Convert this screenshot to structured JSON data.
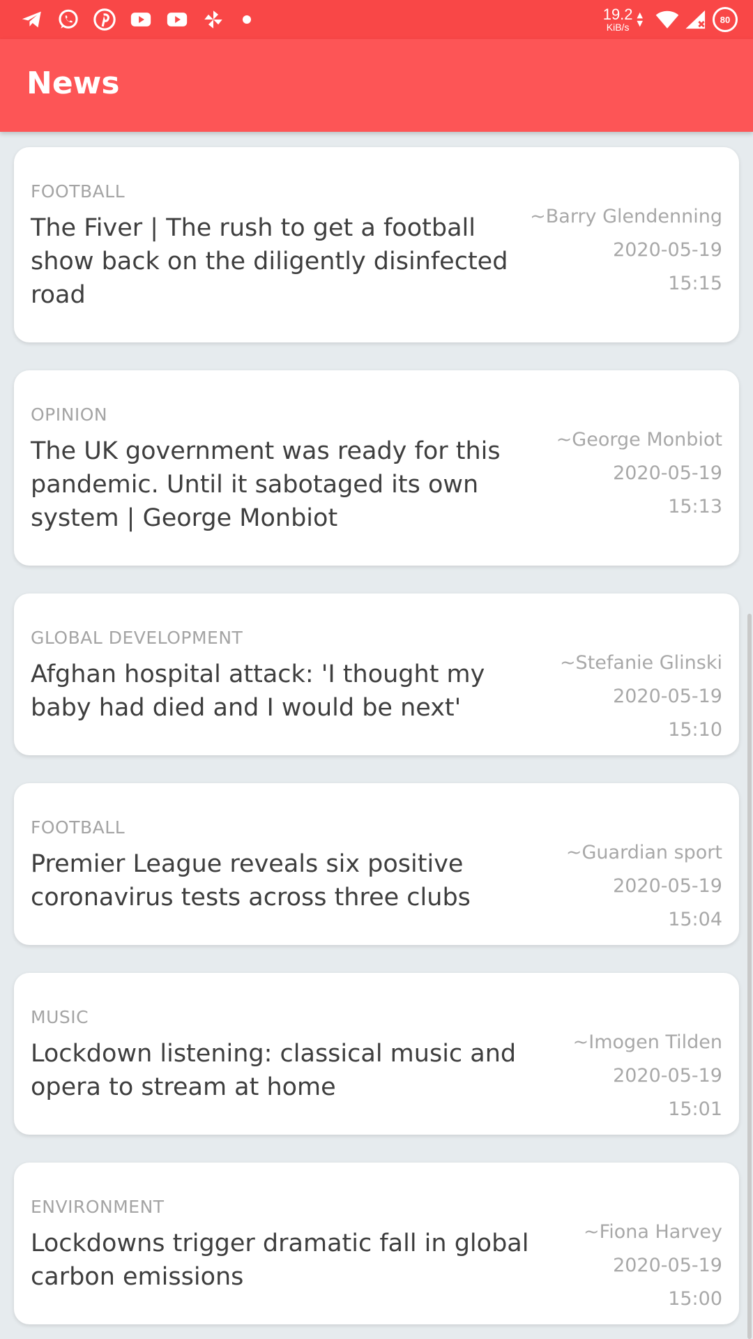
{
  "status_bar": {
    "left_icons": [
      "telegram-icon",
      "whatsapp-icon",
      "pinterest-icon",
      "youtube-icon",
      "youtube-icon",
      "pinwheel-icon",
      "more-notifications-dot"
    ],
    "net_speed_value": "19.2",
    "net_speed_unit": "KiB/s",
    "battery_level": "80"
  },
  "app_bar": {
    "title": "News",
    "background": "#fd5556"
  },
  "articles": [
    {
      "category": "FOOTBALL",
      "headline": "The Fiver | The rush to get a football show back on the diligently disinfected road",
      "author": "~Barry Glendenning",
      "date": "2020-05-19",
      "time": "15:15"
    },
    {
      "category": "OPINION",
      "headline": "The UK government was ready for this pandemic. Until it sabotaged its own system | George Monbiot",
      "author": "~George Monbiot",
      "date": "2020-05-19",
      "time": "15:13"
    },
    {
      "category": "GLOBAL DEVELOPMENT",
      "headline": "Afghan hospital attack: 'I thought my baby had died and I would be next'",
      "author": "~Stefanie Glinski",
      "date": "2020-05-19",
      "time": "15:10"
    },
    {
      "category": "FOOTBALL",
      "headline": "Premier League reveals six positive coronavirus tests across three clubs",
      "author": "~Guardian sport",
      "date": "2020-05-19",
      "time": "15:04"
    },
    {
      "category": "MUSIC",
      "headline": "Lockdown listening: classical music and opera to stream at home",
      "author": "~Imogen Tilden",
      "date": "2020-05-19",
      "time": "15:01"
    },
    {
      "category": "ENVIRONMENT",
      "headline": "Lockdowns trigger dramatic fall in global carbon emissions",
      "author": "~Fiona Harvey",
      "date": "2020-05-19",
      "time": "15:00"
    }
  ]
}
